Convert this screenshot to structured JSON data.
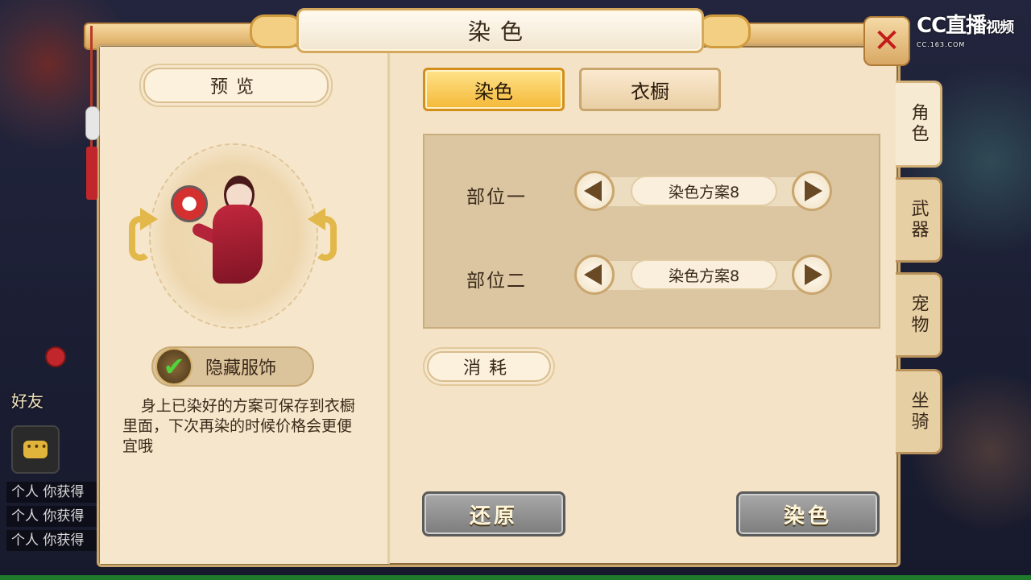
{
  "watermark": {
    "main": "CC直播",
    "side": "视频",
    "sub": "CC.163.COM"
  },
  "window": {
    "title": "染色",
    "close_icon": "close-icon"
  },
  "preview": {
    "label": "预览",
    "hide_costume_label": "隐藏服饰",
    "hide_costume_checked": true,
    "hint": "身上已染好的方案可保存到衣橱里面，下次再染的时候价格会更便宜哦"
  },
  "tabs": [
    {
      "label": "染色",
      "active": true
    },
    {
      "label": "衣橱",
      "active": false
    }
  ],
  "dye_parts": [
    {
      "label": "部位一",
      "scheme": "染色方案8"
    },
    {
      "label": "部位二",
      "scheme": "染色方案8"
    }
  ],
  "cost": {
    "label": "消耗"
  },
  "actions": {
    "restore": "还原",
    "dye": "染色"
  },
  "side_tabs": [
    {
      "label": "角色",
      "active": true
    },
    {
      "label": "武器",
      "active": false
    },
    {
      "label": "宠物",
      "active": false
    },
    {
      "label": "坐骑",
      "active": false
    }
  ],
  "background": {
    "friend_label": "好友",
    "chat_lines": [
      "个人 你获得",
      "个人 你获得",
      "个人 你获得"
    ]
  },
  "colors": {
    "accent": "#f4b838",
    "close": "#c31a1a",
    "check": "#4fd53a"
  }
}
